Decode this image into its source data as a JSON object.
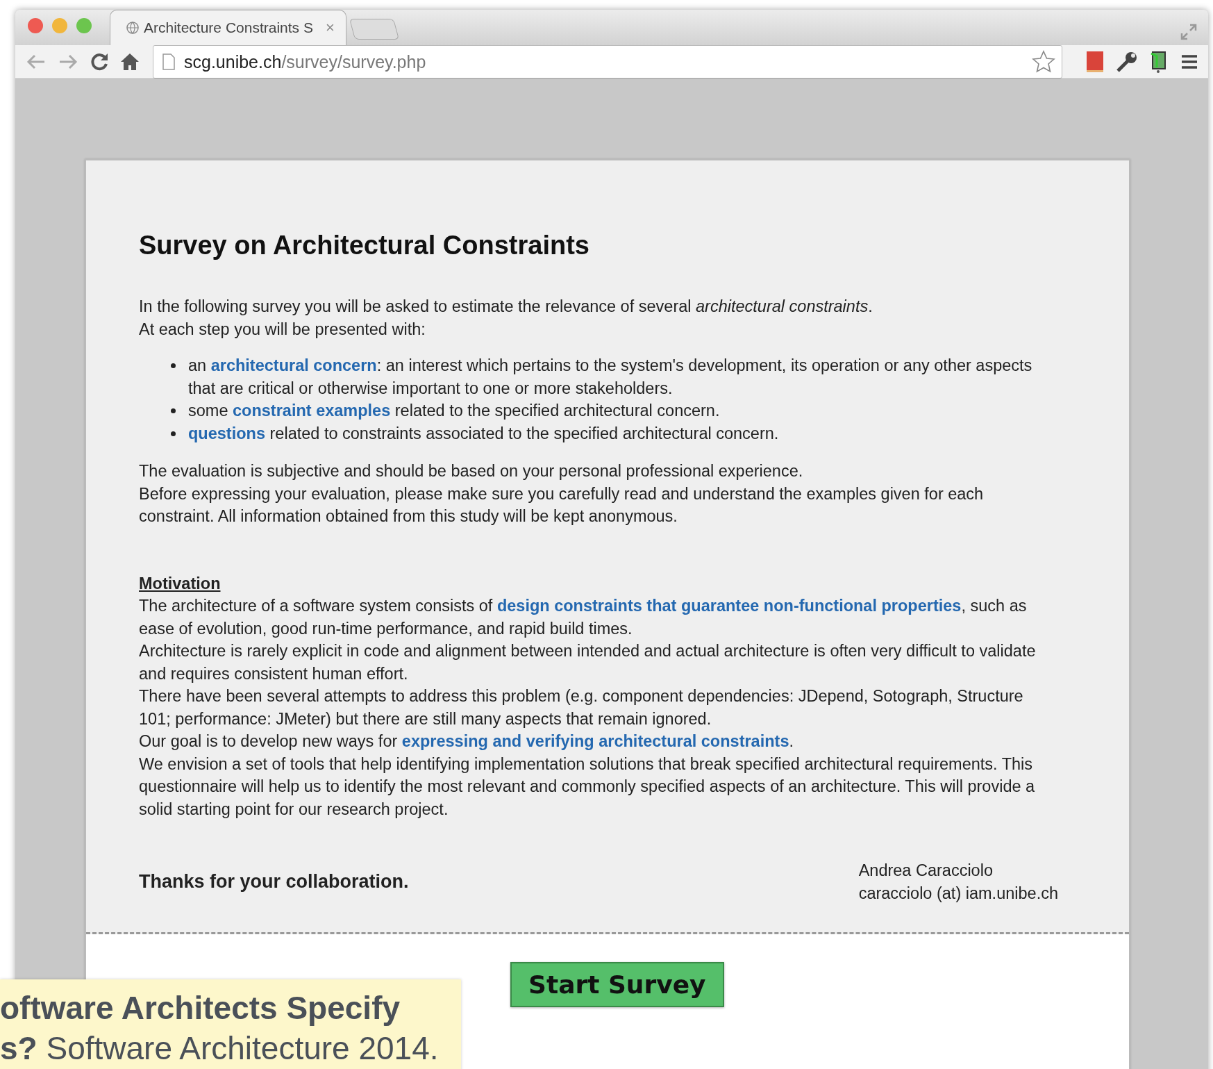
{
  "browser": {
    "tabs": [
      {
        "title": "Architecture Constraints S",
        "close": "×",
        "selected": true
      }
    ],
    "url_host": "scg.unibe.ch",
    "url_path": "/survey/survey.php"
  },
  "page": {
    "title": "Survey on Architectural Constraints",
    "intro": [
      [
        {
          "text": "In the following survey you will be asked to estimate the relevance of several *architectural constraints*.",
          "link": false
        }
      ],
      [
        {
          "text": "At each step you will be presented with:",
          "link": false
        }
      ]
    ],
    "bullets": [
      [
        {
          "text": "an ",
          "link": false
        },
        {
          "text": "architectural concern",
          "link": true
        },
        {
          "text": ": an interest which pertains to the system's development, its operation or any other aspects that are critical or otherwise important to one or more stakeholders.",
          "link": false
        }
      ],
      [
        {
          "text": "some ",
          "link": false
        },
        {
          "text": "constraint examples",
          "link": true
        },
        {
          "text": " related to the specified architectural concern.",
          "link": false
        }
      ],
      [
        {
          "text": "questions",
          "link": true
        },
        {
          "text": " related to constraints associated to the specified architectural concern.",
          "link": false
        }
      ]
    ],
    "evaluation": [
      [
        {
          "text": "The evaluation is subjective and should be based on your personal professional experience.",
          "link": false
        }
      ],
      [
        {
          "text": "Before expressing your evaluation, please make sure you carefully read and understand the examples given for each constraint. All information obtained from this study will be kept anonymous.",
          "link": false
        }
      ]
    ],
    "motivation": {
      "heading": "Motivation",
      "lines": [
        [
          {
            "text": "The architecture of a software system consists of ",
            "link": false
          },
          {
            "text": "design constraints that guarantee non-functional properties",
            "link": true
          },
          {
            "text": ", such as ease of evolution, good run-time performance, and rapid build times.",
            "link": false
          }
        ],
        [
          {
            "text": "Architecture is rarely explicit in code and alignment between intended and actual architecture is often very difficult to validate and requires consistent human effort.",
            "link": false
          }
        ],
        [
          {
            "text": "There have been several attempts to address this problem (e.g. component dependencies: JDepend, Sotograph, Structure 101; performance: JMeter) but there are still many aspects that remain ignored.",
            "link": false
          }
        ],
        [
          {
            "text": "Our goal is to develop new ways for ",
            "link": false
          },
          {
            "text": "expressing and verifying architectural constraints",
            "link": true
          },
          {
            "text": ".",
            "link": false
          }
        ],
        [
          {
            "text": "We envision a set of tools that help identifying implementation solutions that break specified architectural requirements. This questionnaire will help us to identify the most relevant and commonly specified aspects of an architecture. This will provide a solid starting point for our research project.",
            "link": false
          }
        ]
      ]
    },
    "thanks": "Thanks for your collaboration.",
    "author": {
      "name": "Andrea Caracciolo",
      "email": "caracciolo (at) iam.unibe.ch"
    },
    "start_button": "Start Survey"
  },
  "caption": {
    "text": "**oftware Architects Specify\ns?** Software Architecture 2014."
  }
}
